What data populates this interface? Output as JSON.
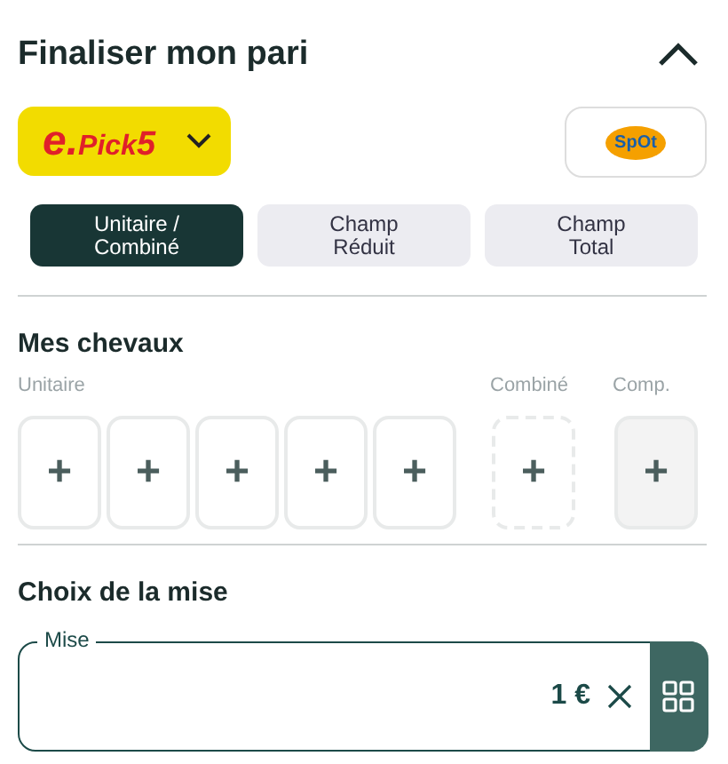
{
  "header": {
    "title": "Finaliser mon pari",
    "expanded": true
  },
  "bet_type": {
    "logo_prefix": "e.",
    "logo_name": "Pick",
    "logo_number": "5"
  },
  "spot_button": {
    "label": "SpOt"
  },
  "tabs": [
    {
      "label": "Unitaire / Combiné",
      "selected": true
    },
    {
      "label": "Champ Réduit",
      "selected": false
    },
    {
      "label": "Champ Total",
      "selected": false
    }
  ],
  "horses": {
    "title": "Mes chevaux",
    "groups": [
      {
        "label": "Unitaire",
        "kind": "unitaire",
        "slots": [
          "+",
          "+",
          "+",
          "+",
          "+"
        ]
      },
      {
        "label": "Combiné",
        "kind": "combine",
        "slots": [
          "+"
        ]
      },
      {
        "label": "Comp.",
        "kind": "complement",
        "slots": [
          "+"
        ]
      }
    ]
  },
  "stake": {
    "title": "Choix de la mise",
    "field_label": "Mise",
    "value": "1 €"
  }
}
